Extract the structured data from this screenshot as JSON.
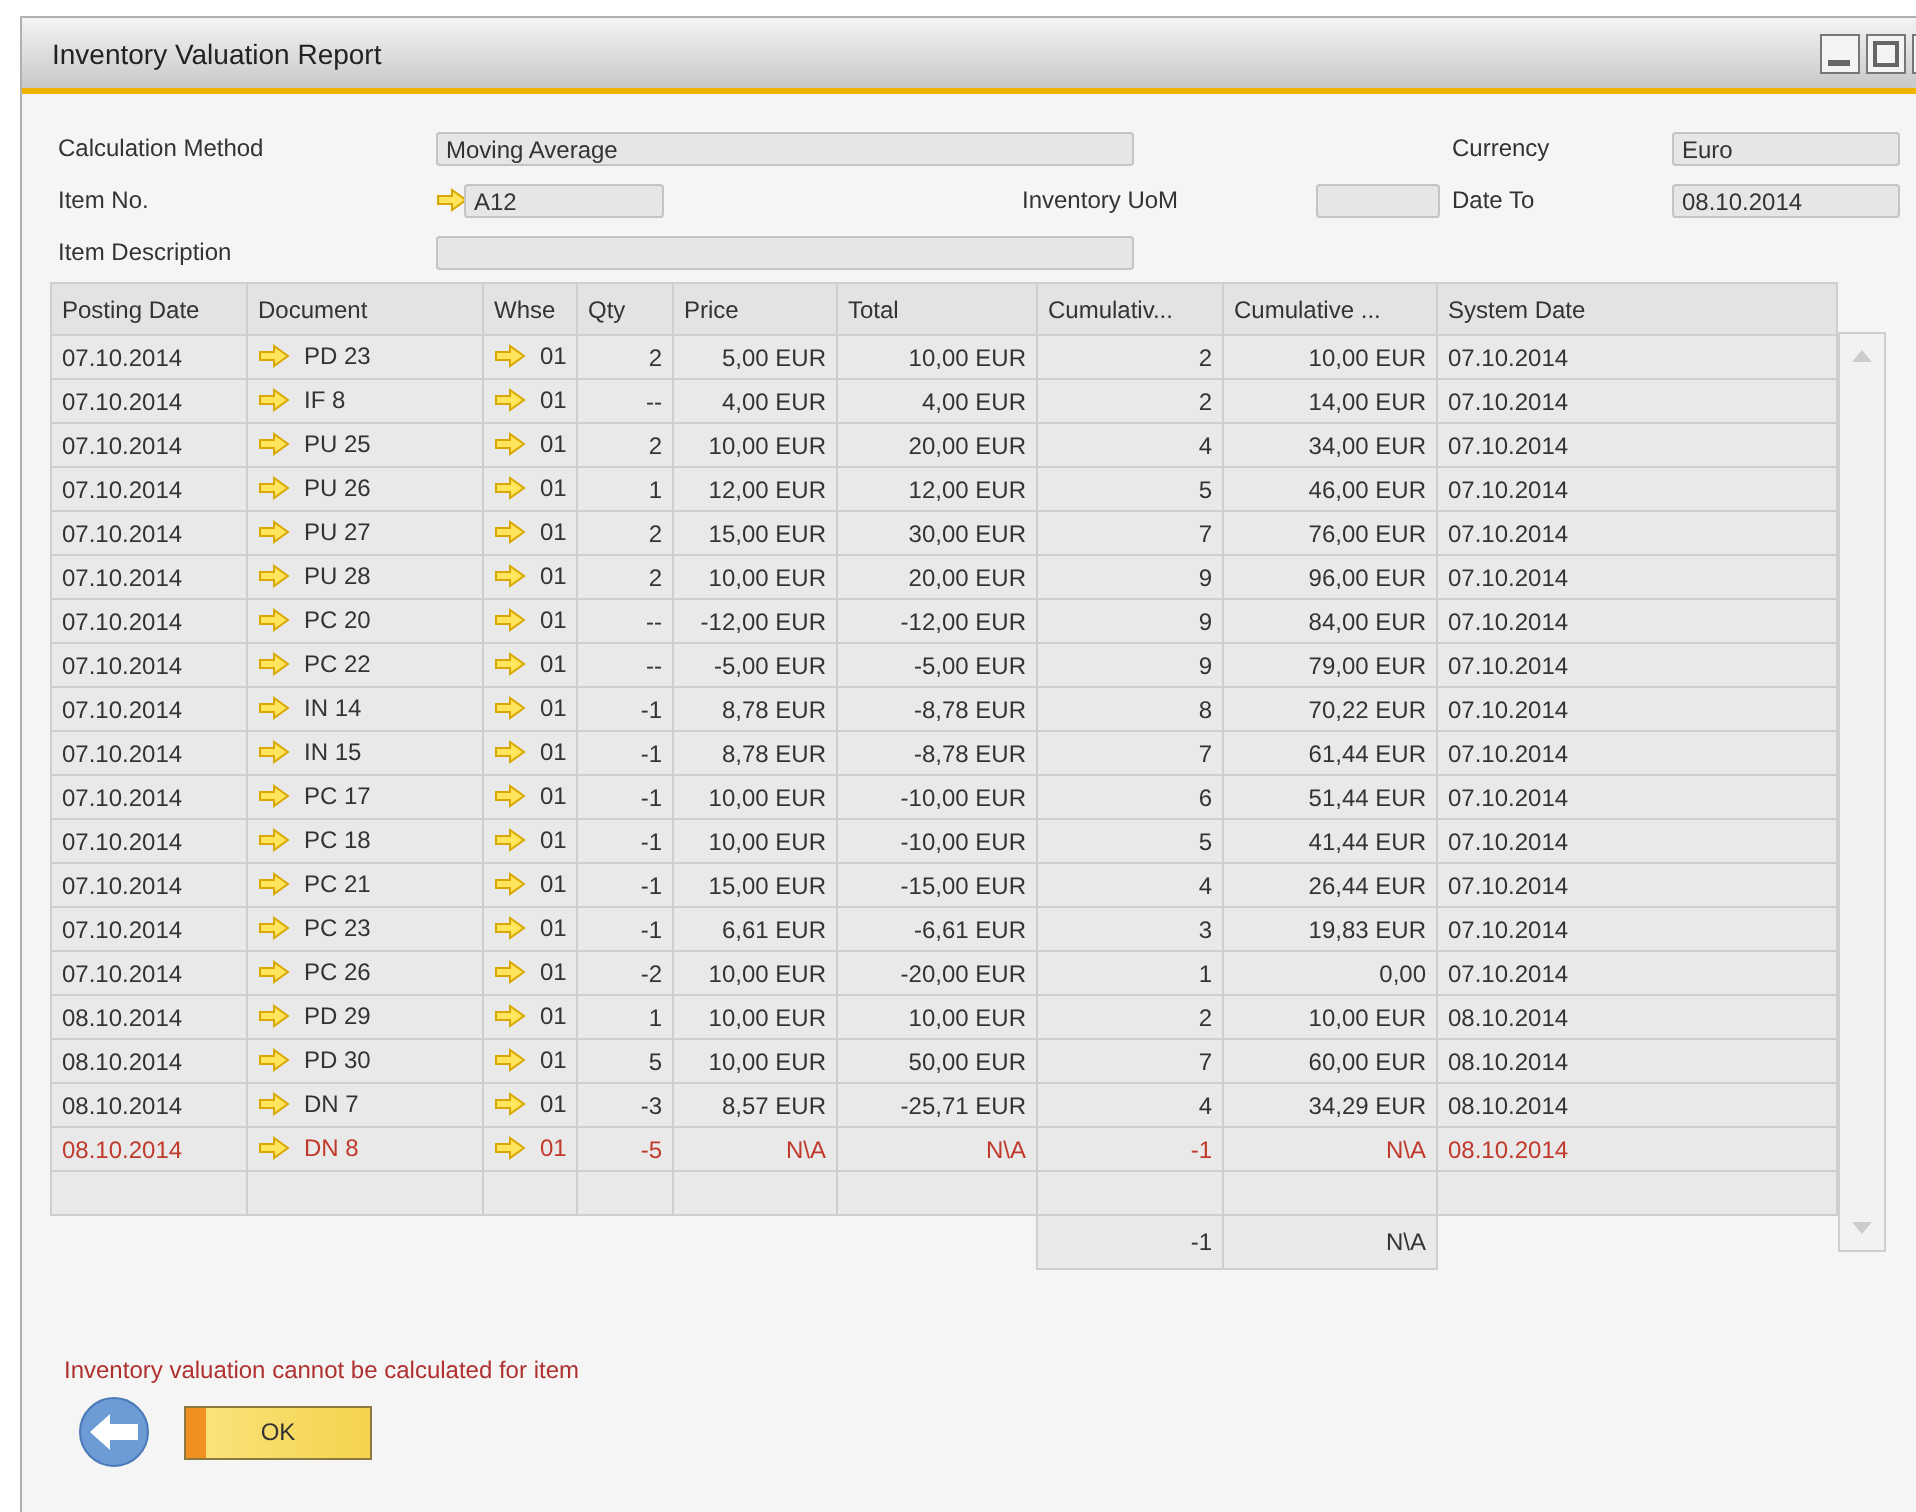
{
  "window": {
    "title": "Inventory Valuation Report"
  },
  "form": {
    "calculation_method": {
      "label": "Calculation Method",
      "value": "Moving Average"
    },
    "currency": {
      "label": "Currency",
      "value": "Euro"
    },
    "item_no": {
      "label": "Item No.",
      "value": "A12"
    },
    "inventory_uom": {
      "label": "Inventory UoM"
    },
    "date_to": {
      "label": "Date To",
      "value": "08.10.2014"
    },
    "item_description": {
      "label": "Item Description"
    }
  },
  "table": {
    "columns": [
      "Posting Date",
      "Document",
      "Whse",
      "Qty",
      "Price",
      "Total",
      "Cumulativ...",
      "Cumulative ...",
      "System Date"
    ],
    "rows": [
      {
        "error": false,
        "cells": [
          "07.10.2014",
          "PD 23",
          "01",
          "2",
          "5,00 EUR",
          "10,00 EUR",
          "2",
          "10,00 EUR",
          "07.10.2014"
        ]
      },
      {
        "error": false,
        "cells": [
          "07.10.2014",
          "IF 8",
          "01",
          "--",
          "4,00 EUR",
          "4,00 EUR",
          "2",
          "14,00 EUR",
          "07.10.2014"
        ]
      },
      {
        "error": false,
        "cells": [
          "07.10.2014",
          "PU 25",
          "01",
          "2",
          "10,00 EUR",
          "20,00 EUR",
          "4",
          "34,00 EUR",
          "07.10.2014"
        ]
      },
      {
        "error": false,
        "cells": [
          "07.10.2014",
          "PU 26",
          "01",
          "1",
          "12,00 EUR",
          "12,00 EUR",
          "5",
          "46,00 EUR",
          "07.10.2014"
        ]
      },
      {
        "error": false,
        "cells": [
          "07.10.2014",
          "PU 27",
          "01",
          "2",
          "15,00 EUR",
          "30,00 EUR",
          "7",
          "76,00 EUR",
          "07.10.2014"
        ]
      },
      {
        "error": false,
        "cells": [
          "07.10.2014",
          "PU 28",
          "01",
          "2",
          "10,00 EUR",
          "20,00 EUR",
          "9",
          "96,00 EUR",
          "07.10.2014"
        ]
      },
      {
        "error": false,
        "cells": [
          "07.10.2014",
          "PC 20",
          "01",
          "--",
          "-12,00 EUR",
          "-12,00 EUR",
          "9",
          "84,00 EUR",
          "07.10.2014"
        ]
      },
      {
        "error": false,
        "cells": [
          "07.10.2014",
          "PC 22",
          "01",
          "--",
          "-5,00 EUR",
          "-5,00 EUR",
          "9",
          "79,00 EUR",
          "07.10.2014"
        ]
      },
      {
        "error": false,
        "cells": [
          "07.10.2014",
          "IN 14",
          "01",
          "-1",
          "8,78 EUR",
          "-8,78 EUR",
          "8",
          "70,22 EUR",
          "07.10.2014"
        ]
      },
      {
        "error": false,
        "cells": [
          "07.10.2014",
          "IN 15",
          "01",
          "-1",
          "8,78 EUR",
          "-8,78 EUR",
          "7",
          "61,44 EUR",
          "07.10.2014"
        ]
      },
      {
        "error": false,
        "cells": [
          "07.10.2014",
          "PC 17",
          "01",
          "-1",
          "10,00 EUR",
          "-10,00 EUR",
          "6",
          "51,44 EUR",
          "07.10.2014"
        ]
      },
      {
        "error": false,
        "cells": [
          "07.10.2014",
          "PC 18",
          "01",
          "-1",
          "10,00 EUR",
          "-10,00 EUR",
          "5",
          "41,44 EUR",
          "07.10.2014"
        ]
      },
      {
        "error": false,
        "cells": [
          "07.10.2014",
          "PC 21",
          "01",
          "-1",
          "15,00 EUR",
          "-15,00 EUR",
          "4",
          "26,44 EUR",
          "07.10.2014"
        ]
      },
      {
        "error": false,
        "cells": [
          "07.10.2014",
          "PC 23",
          "01",
          "-1",
          "6,61 EUR",
          "-6,61 EUR",
          "3",
          "19,83 EUR",
          "07.10.2014"
        ]
      },
      {
        "error": false,
        "cells": [
          "07.10.2014",
          "PC 26",
          "01",
          "-2",
          "10,00 EUR",
          "-20,00 EUR",
          "1",
          "0,00",
          "07.10.2014"
        ]
      },
      {
        "error": false,
        "cells": [
          "08.10.2014",
          "PD 29",
          "01",
          "1",
          "10,00 EUR",
          "10,00 EUR",
          "2",
          "10,00 EUR",
          "08.10.2014"
        ]
      },
      {
        "error": false,
        "cells": [
          "08.10.2014",
          "PD 30",
          "01",
          "5",
          "10,00 EUR",
          "50,00 EUR",
          "7",
          "60,00 EUR",
          "08.10.2014"
        ]
      },
      {
        "error": false,
        "cells": [
          "08.10.2014",
          "DN 7",
          "01",
          "-3",
          "8,57 EUR",
          "-25,71 EUR",
          "4",
          "34,29 EUR",
          "08.10.2014"
        ]
      },
      {
        "error": true,
        "cells": [
          "08.10.2014",
          "DN 8",
          "01",
          "-5",
          "N\\A",
          "N\\A",
          "-1",
          "N\\A",
          "08.10.2014"
        ]
      }
    ],
    "totals": {
      "cumulative_qty": "-1",
      "cumulative_value": "N\\A"
    }
  },
  "message": "Inventory valuation cannot be calculated for item",
  "buttons": {
    "ok": "OK"
  }
}
